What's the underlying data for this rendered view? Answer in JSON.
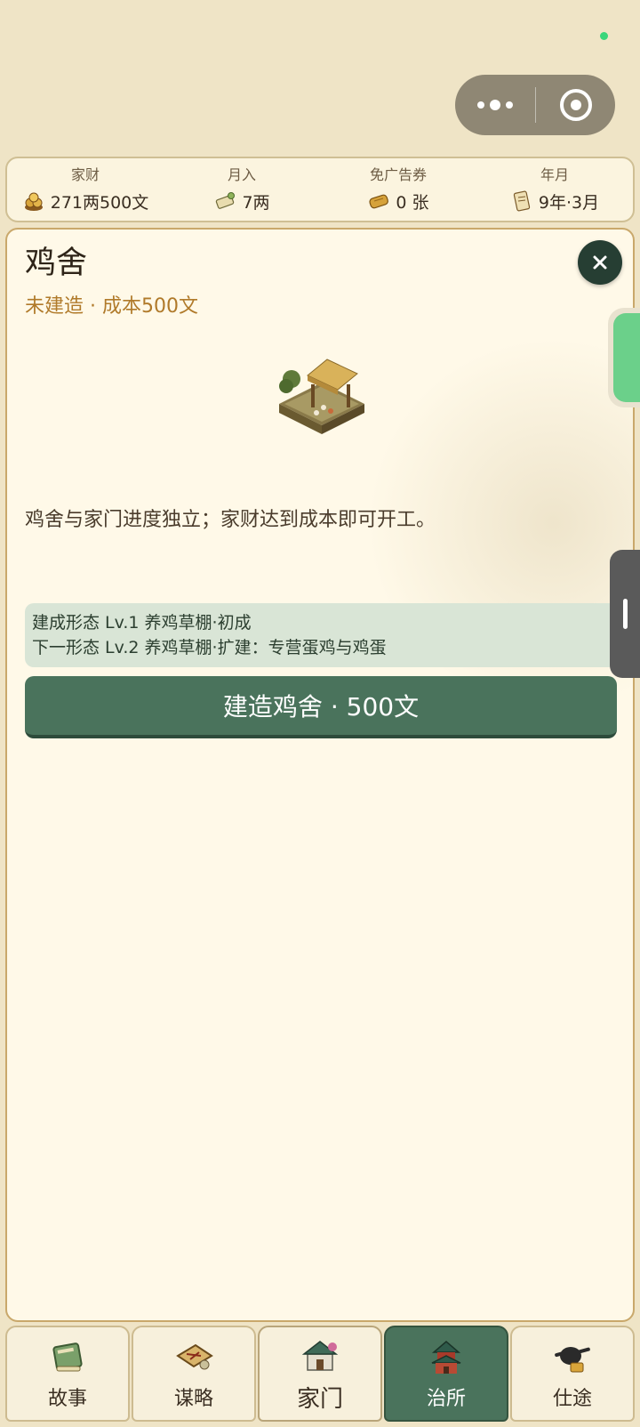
{
  "resources": [
    {
      "label": "家财",
      "value": "271两500文",
      "icon": "coin-pile-icon"
    },
    {
      "label": "月入",
      "value": "7两",
      "icon": "scroll-income-icon"
    },
    {
      "label": "免广告券",
      "value": "0 张",
      "icon": "ticket-icon"
    },
    {
      "label": "年月",
      "value": "9年·3月",
      "icon": "calendar-scroll-icon"
    }
  ],
  "panel": {
    "title": "鸡舍",
    "subtitle": "未建造 · 成本500文",
    "description": "鸡舍与家门进度独立；家财达到成本即可开工。",
    "form_current": "建成形态 Lv.1 养鸡草棚·初成",
    "form_next": "下一形态 Lv.2 养鸡草棚·扩建：专营蛋鸡与鸡蛋",
    "build_button": "建造鸡舍 · 500文",
    "building_icon": "chicken-coop-icon"
  },
  "tabs": [
    {
      "label": "故事",
      "icon": "story-book-icon",
      "active": false
    },
    {
      "label": "谋略",
      "icon": "strategy-scroll-icon",
      "active": false
    },
    {
      "label": "家门",
      "icon": "family-house-icon",
      "active": false
    },
    {
      "label": "治所",
      "icon": "government-tower-icon",
      "active": true
    },
    {
      "label": "仕途",
      "icon": "official-hat-icon",
      "active": false
    }
  ],
  "colors": {
    "accent_green": "#4a735c",
    "subtitle_gold": "#b07a2a",
    "page_bg": "#efe4c6"
  }
}
